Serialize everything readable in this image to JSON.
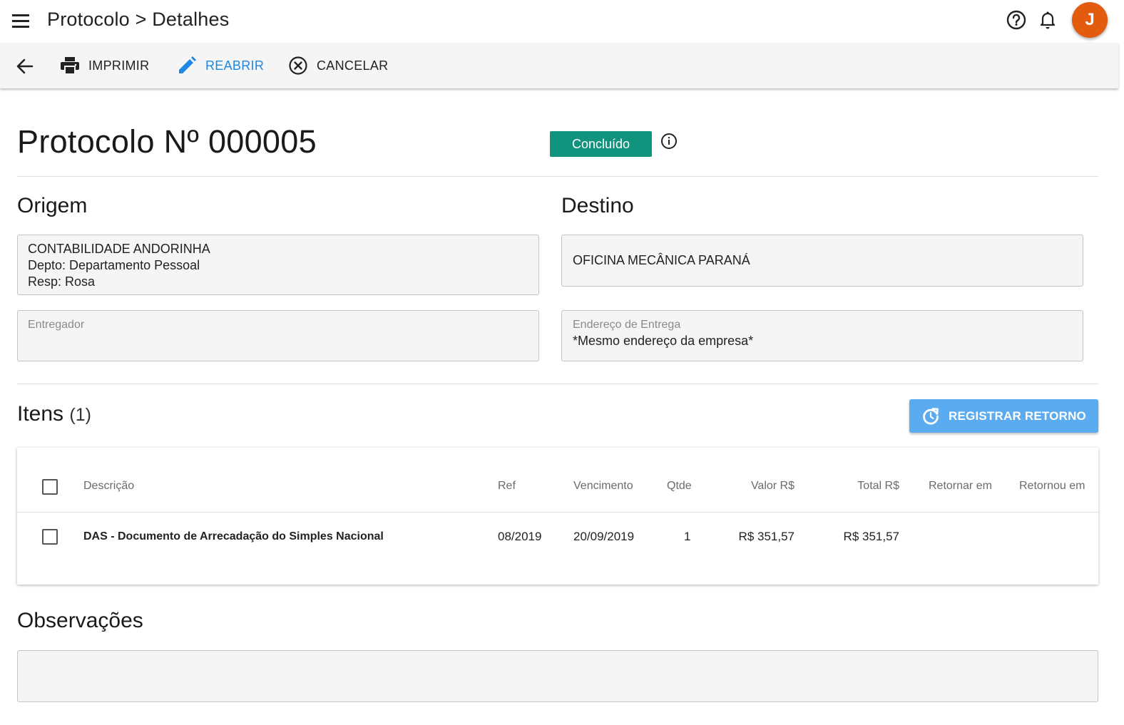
{
  "appbar": {
    "breadcrumb": "Protocolo > Detalhes",
    "avatar_initial": "J",
    "avatar_color": "#e35b0e"
  },
  "toolbar": {
    "print_label": "IMPRIMIR",
    "reopen_label": "REABRIR",
    "cancel_label": "CANCELAR",
    "accent_color": "#1e88e5"
  },
  "header": {
    "title": "Protocolo Nº 000005",
    "status": "Concluído",
    "status_color": "#12937e"
  },
  "origem": {
    "heading": "Origem",
    "company": "CONTABILIDADE ANDORINHA",
    "dept": "Depto: Departamento Pessoal",
    "resp": "Resp: Rosa",
    "deliverer_label": "Entregador",
    "deliverer_value": ""
  },
  "destino": {
    "heading": "Destino",
    "company": "OFICINA MECÂNICA PARANÁ",
    "address_label": "Endereço de Entrega",
    "address_value": "*Mesmo endereço da empresa*"
  },
  "itens": {
    "heading": "Itens",
    "count": "(1)",
    "register_button": "REGISTRAR RETORNO",
    "register_color": "#5aabf0",
    "columns": {
      "descricao": "Descrição",
      "ref": "Ref",
      "vencimento": "Vencimento",
      "qtde": "Qtde",
      "valor": "Valor R$",
      "total": "Total R$",
      "retornar": "Retornar em",
      "retornou": "Retornou em"
    },
    "rows": [
      {
        "descricao": "DAS - Documento de Arrecadação do Simples Nacional",
        "ref": "08/2019",
        "vencimento": "20/09/2019",
        "qtde": "1",
        "valor": "R$ 351,57",
        "total": "R$ 351,57",
        "retornar": "",
        "retornou": ""
      }
    ]
  },
  "observacoes": {
    "heading": "Observações",
    "value": ""
  }
}
